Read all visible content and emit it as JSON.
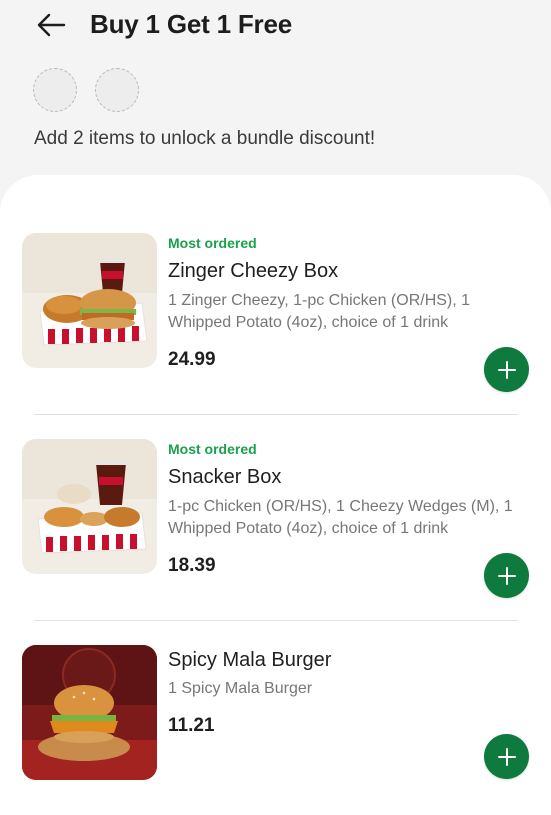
{
  "header": {
    "title": "Buy 1 Get 1 Free",
    "back_icon": "arrow-left-icon"
  },
  "bundle": {
    "slots_total": 2,
    "slots_filled": 0,
    "hint": "Add 2 items to unlock a bundle discount!"
  },
  "items": [
    {
      "badge": "Most ordered",
      "name": "Zinger Cheezy Box",
      "description": "1 Zinger Cheezy, 1-pc Chicken (OR/HS), 1 Whipped Potato (4oz), choice of 1 drink",
      "price": "24.99",
      "image": "zinger-cheezy-box-image"
    },
    {
      "badge": "Most ordered",
      "name": "Snacker Box",
      "description": "1-pc Chicken (OR/HS), 1 Cheezy Wedges (M), 1 Whipped Potato (4oz), choice of 1 drink",
      "price": "18.39",
      "image": "snacker-box-image"
    },
    {
      "badge": "",
      "name": "Spicy Mala Burger",
      "description": "1 Spicy Mala Burger",
      "price": "11.21",
      "image": "spicy-mala-burger-image"
    }
  ],
  "colors": {
    "accent_green": "#0f7a3d",
    "badge_green": "#1aa14b",
    "background": "#f4f4f4",
    "sheet": "#ffffff"
  },
  "icons": {
    "add": "plus-icon"
  }
}
